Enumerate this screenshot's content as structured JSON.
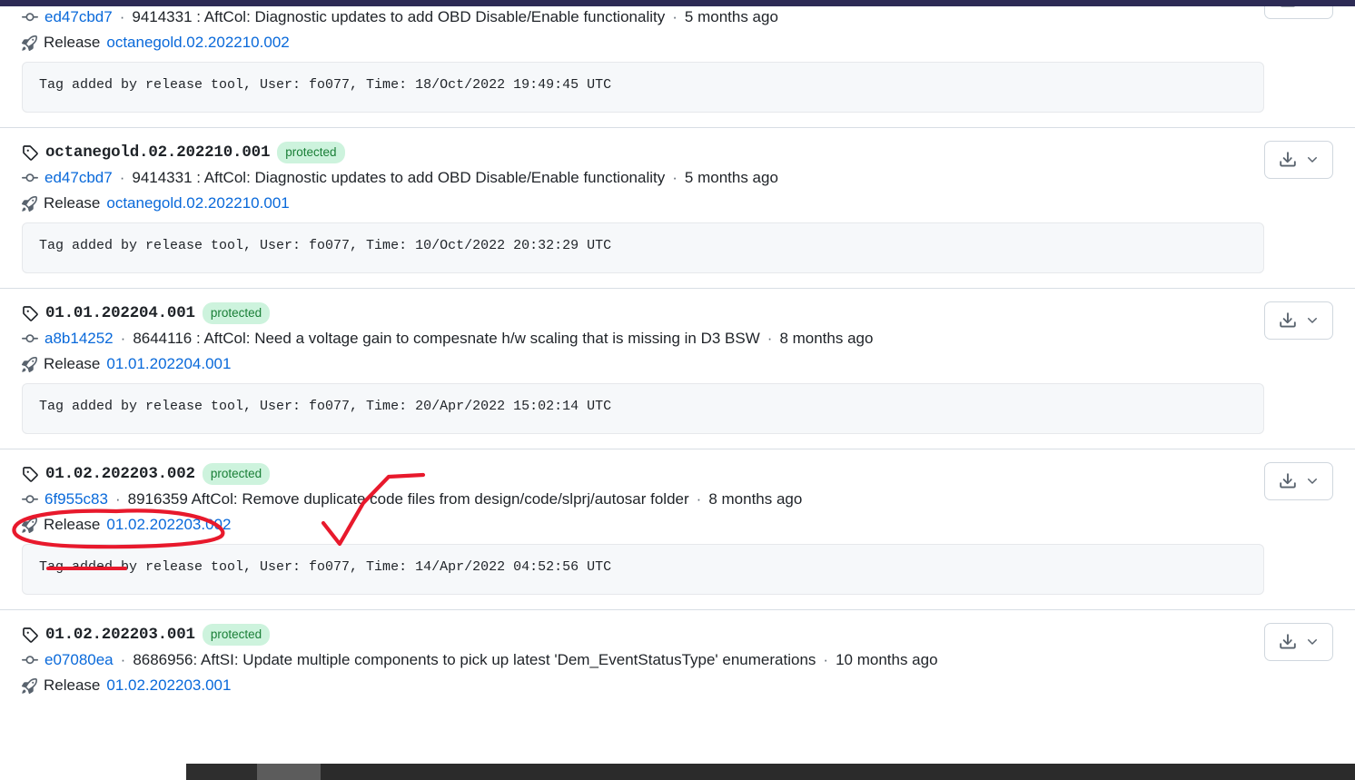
{
  "window": {
    "top_bar_color": "#2d2b55",
    "page_background": "#ffffff"
  },
  "theme": {
    "link_blue": "#0969da",
    "badge_bg": "#cdf3dd",
    "badge_text": "#1a7f37",
    "code_bg": "#f6f8fa",
    "border": "#d8dee4",
    "annotation_red": "#e8192c"
  },
  "labels": {
    "release_prefix": "Release",
    "download_button_title": "Download source code",
    "protected_badge": "protected"
  },
  "icons": {
    "tag": "tag-icon",
    "commit": "git-commit-icon",
    "release": "rocket-icon",
    "download": "download-icon",
    "chevron": "chevron-down-icon"
  },
  "tags": [
    {
      "name": "",
      "protected": false,
      "clipped": true,
      "commit": {
        "sha": "ed47cbd7",
        "message": "9414331 : AftCol: Diagnostic updates to add OBD Disable/Enable functionality",
        "age": "5 months ago"
      },
      "release": "octanegold.02.202210.002",
      "tag_message": "Tag added by release tool, User: fo077, Time: 18/Oct/2022 19:49:45 UTC"
    },
    {
      "name": "octanegold.02.202210.001",
      "protected": true,
      "clipped": false,
      "commit": {
        "sha": "ed47cbd7",
        "message": "9414331 : AftCol: Diagnostic updates to add OBD Disable/Enable functionality",
        "age": "5 months ago"
      },
      "release": "octanegold.02.202210.001",
      "tag_message": "Tag added by release tool, User: fo077, Time: 10/Oct/2022 20:32:29 UTC"
    },
    {
      "name": "01.01.202204.001",
      "protected": true,
      "clipped": false,
      "commit": {
        "sha": "a8b14252",
        "message": "8644116 : AftCol: Need a voltage gain to compesnate h/w scaling that is missing in D3 BSW",
        "age": "8 months ago"
      },
      "release": "01.01.202204.001",
      "tag_message": "Tag added by release tool, User: fo077, Time: 20/Apr/2022 15:02:14 UTC"
    },
    {
      "name": "01.02.202203.002",
      "protected": true,
      "clipped": false,
      "highlighted": true,
      "commit": {
        "sha": "6f955c83",
        "message": "8916359 AftCol: Remove duplicate code files from design/code/slprj/autosar folder",
        "age": "8 months ago"
      },
      "release": "01.02.202203.002",
      "tag_message": "Tag added by release tool, User: fo077, Time: 14/Apr/2022 04:52:56 UTC"
    },
    {
      "name": "01.02.202203.001",
      "protected": true,
      "clipped": false,
      "truncated_bottom": true,
      "commit": {
        "sha": "e07080ea",
        "message": "8686956: AftSI: Update multiple components to pick up latest 'Dem_EventStatusType' enumerations",
        "age": "10 months ago"
      },
      "release": "01.02.202203.001",
      "tag_message": ""
    }
  ],
  "annotations": [
    {
      "type": "ellipse",
      "target": "tag-name-01.02.202203.002"
    },
    {
      "type": "checkmark",
      "target": "right-of-protected-badge"
    },
    {
      "type": "underline",
      "target": "commit-sha-6f955c83"
    }
  ],
  "taskbar": {
    "clock": ""
  }
}
